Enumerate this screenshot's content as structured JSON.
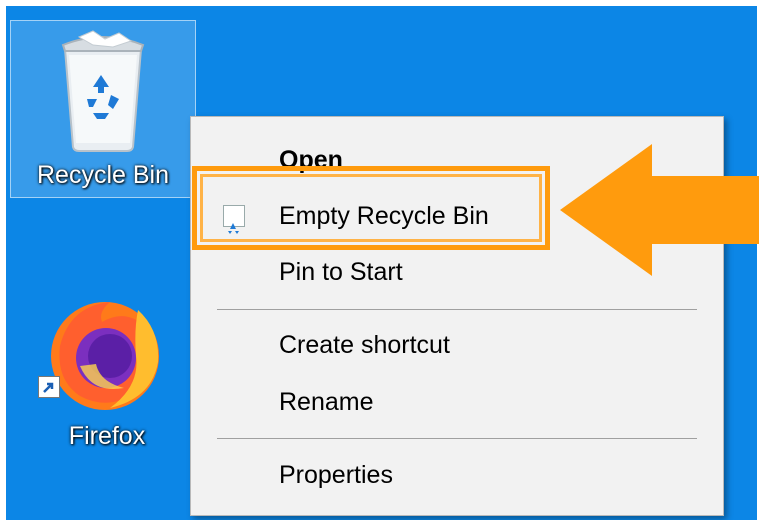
{
  "desktop": {
    "background_color": "#0c86e6",
    "icons": [
      {
        "label": "Recycle Bin",
        "icon": "recycle-bin-icon",
        "selected": true
      },
      {
        "label": "Firefox",
        "icon": "firefox-icon",
        "shortcut": true
      }
    ]
  },
  "context_menu": {
    "items": [
      {
        "label": "Open",
        "bold": true
      },
      {
        "label": "Empty Recycle Bin",
        "icon": "recycle-small-icon",
        "highlighted": true
      },
      {
        "label": "Pin to Start"
      },
      {
        "separator": true
      },
      {
        "label": "Create shortcut"
      },
      {
        "label": "Rename"
      },
      {
        "separator": true
      },
      {
        "label": "Properties"
      }
    ]
  },
  "annotation": {
    "color": "#ff9b0d",
    "type": "arrow-and-box",
    "target": "Empty Recycle Bin"
  }
}
